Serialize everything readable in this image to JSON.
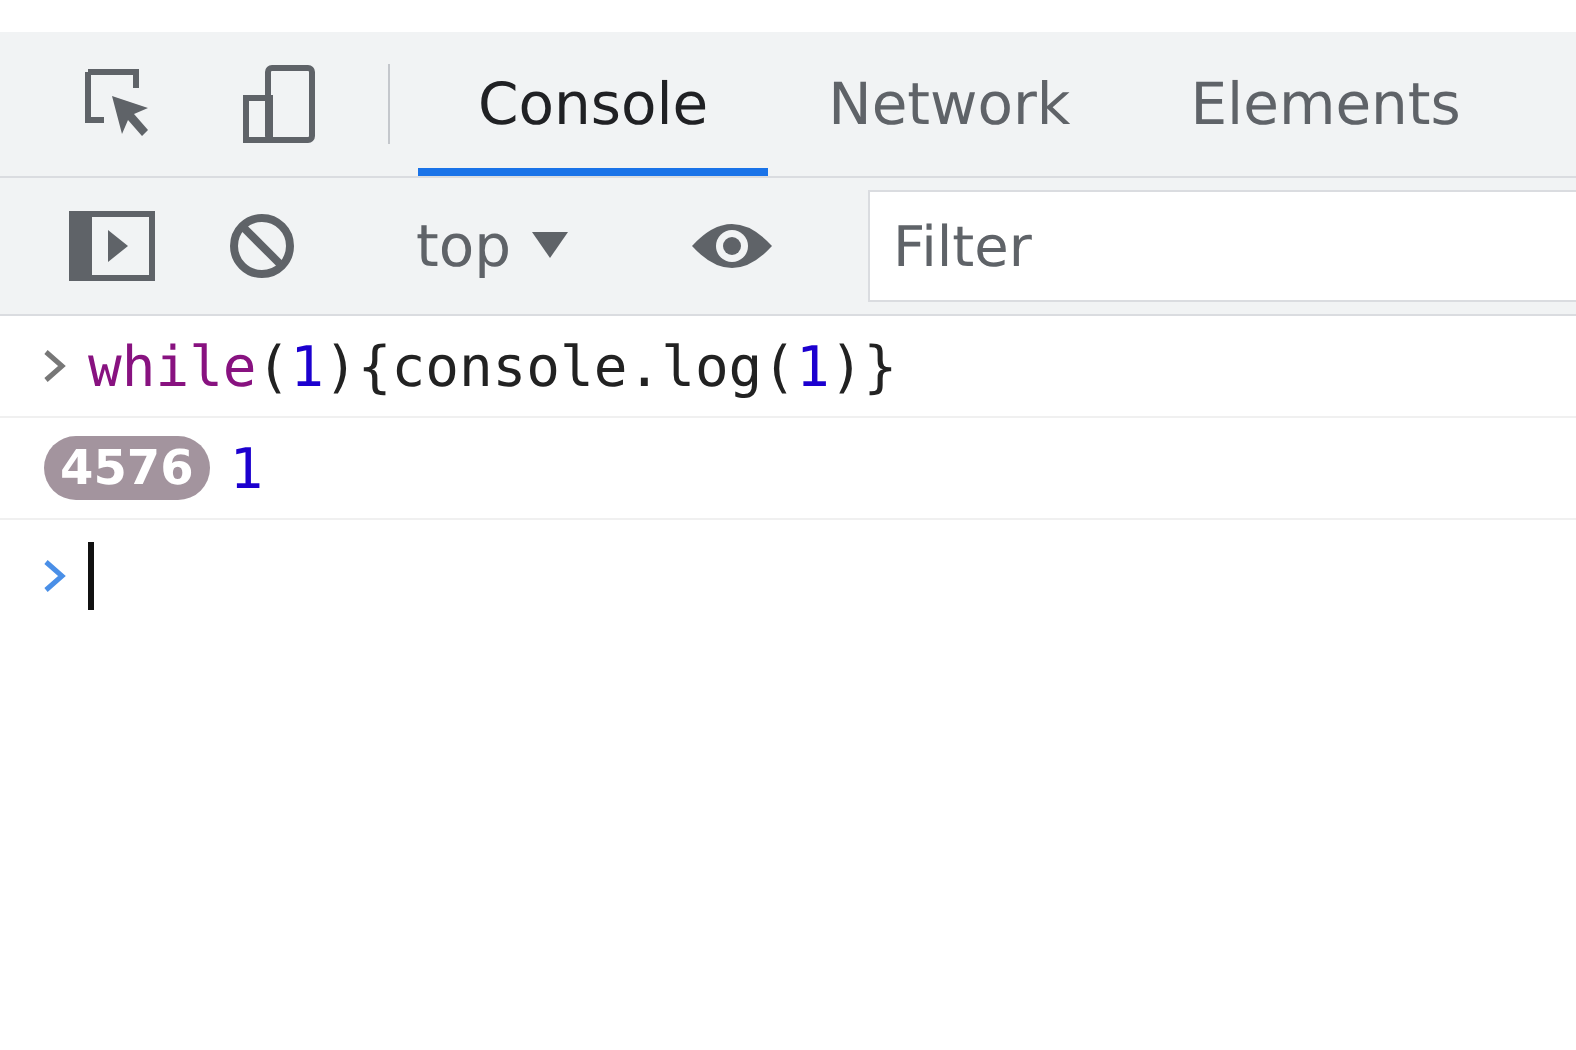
{
  "tabs": [
    {
      "label": "Console",
      "selected": true
    },
    {
      "label": "Network",
      "selected": false
    },
    {
      "label": "Elements",
      "selected": false
    }
  ],
  "console_toolbar": {
    "context": "top",
    "filter": {
      "placeholder": "Filter"
    }
  },
  "entries": [
    {
      "kind": "input",
      "tokens": [
        {
          "kind": "keyword",
          "text": "while"
        },
        {
          "kind": "plain",
          "text": "("
        },
        {
          "kind": "number",
          "text": "1"
        },
        {
          "kind": "plain",
          "text": "){console.log("
        },
        {
          "kind": "number",
          "text": "1"
        },
        {
          "kind": "plain",
          "text": ")}"
        }
      ]
    },
    {
      "kind": "log",
      "count": "4576",
      "text": "1"
    }
  ]
}
